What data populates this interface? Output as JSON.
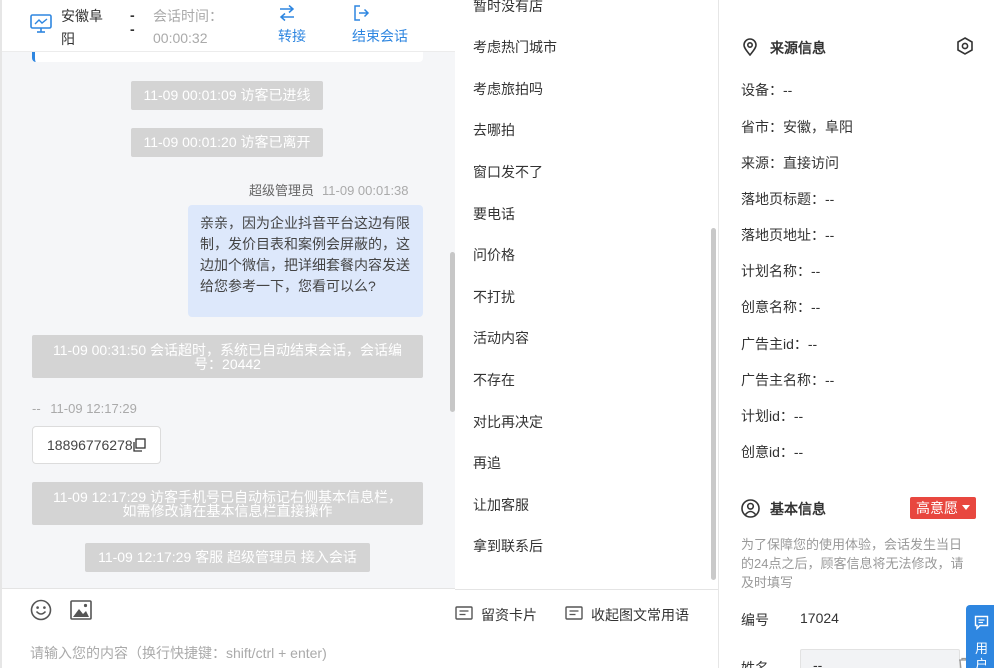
{
  "header": {
    "location": "安徽阜阳",
    "dash": "--",
    "session_time_label": "会话时间：",
    "session_time": "00:00:32",
    "transfer_label": "转接",
    "end_label": "结束会话"
  },
  "messages": {
    "sys1": "11-09 00:01:09 访客已进线",
    "sys2": "11-09 00:01:20 访客已离开",
    "agent_name": "超级管理员",
    "agent_time": "11-09 00:01:38",
    "agent_text": "亲亲，因为企业抖音平台这边有限制，发价目表和案例会屏蔽的，这边加个微信，把详细套餐内容发送给您参考一下，您看可以么?",
    "sys3": "11-09 00:31:50 会话超时，系统已自动结束会话，会话编号：20442",
    "visitor_name": "--",
    "visitor_time": "11-09 12:17:29",
    "phone": "18896776278",
    "sys4": "11-09 12:17:29 访客手机号已自动标记右侧基本信息栏，如需修改请在基本信息栏直接操作",
    "sys5": "11-09 12:17:29 客服 超级管理员 接入会话"
  },
  "input": {
    "placeholder": "请输入您的内容（换行快捷键：shift/ctrl + enter)"
  },
  "quick_replies": {
    "items": [
      "暂时没有店",
      "考虑热门城市",
      "考虑旅拍吗",
      "去哪拍",
      "窗口发不了",
      "要电话",
      "问价格",
      "不打扰",
      "活动内容",
      "不存在",
      "对比再决定",
      "再追",
      "让加客服",
      "拿到联系后"
    ],
    "card_label": "留资卡片",
    "collapse_label": "收起图文常用语"
  },
  "source_info": {
    "title": "来源信息",
    "rows": [
      "设备：--",
      "省市：安徽，阜阳",
      "来源：直接访问",
      "落地页标题：--",
      "落地页地址：--",
      "计划名称：--",
      "创意名称：--",
      "广告主id：--",
      "广告主名称：--",
      "计划id：--",
      "创意id：--"
    ]
  },
  "basic_info": {
    "title": "基本信息",
    "intent": "高意愿",
    "notice": "为了保障您的使用体验，会话发生当日的24点之后，顾客信息将无法修改，请及时填写",
    "id_label": "编号",
    "id_value": "17024",
    "name_label": "姓名",
    "name_value": "--"
  },
  "float_button": {
    "label": "用户"
  },
  "colors": {
    "accent": "#2e86e0",
    "bubble": "#dde8fb",
    "system_msg": "#d4d4d4",
    "intent_badge": "#e8473f"
  }
}
